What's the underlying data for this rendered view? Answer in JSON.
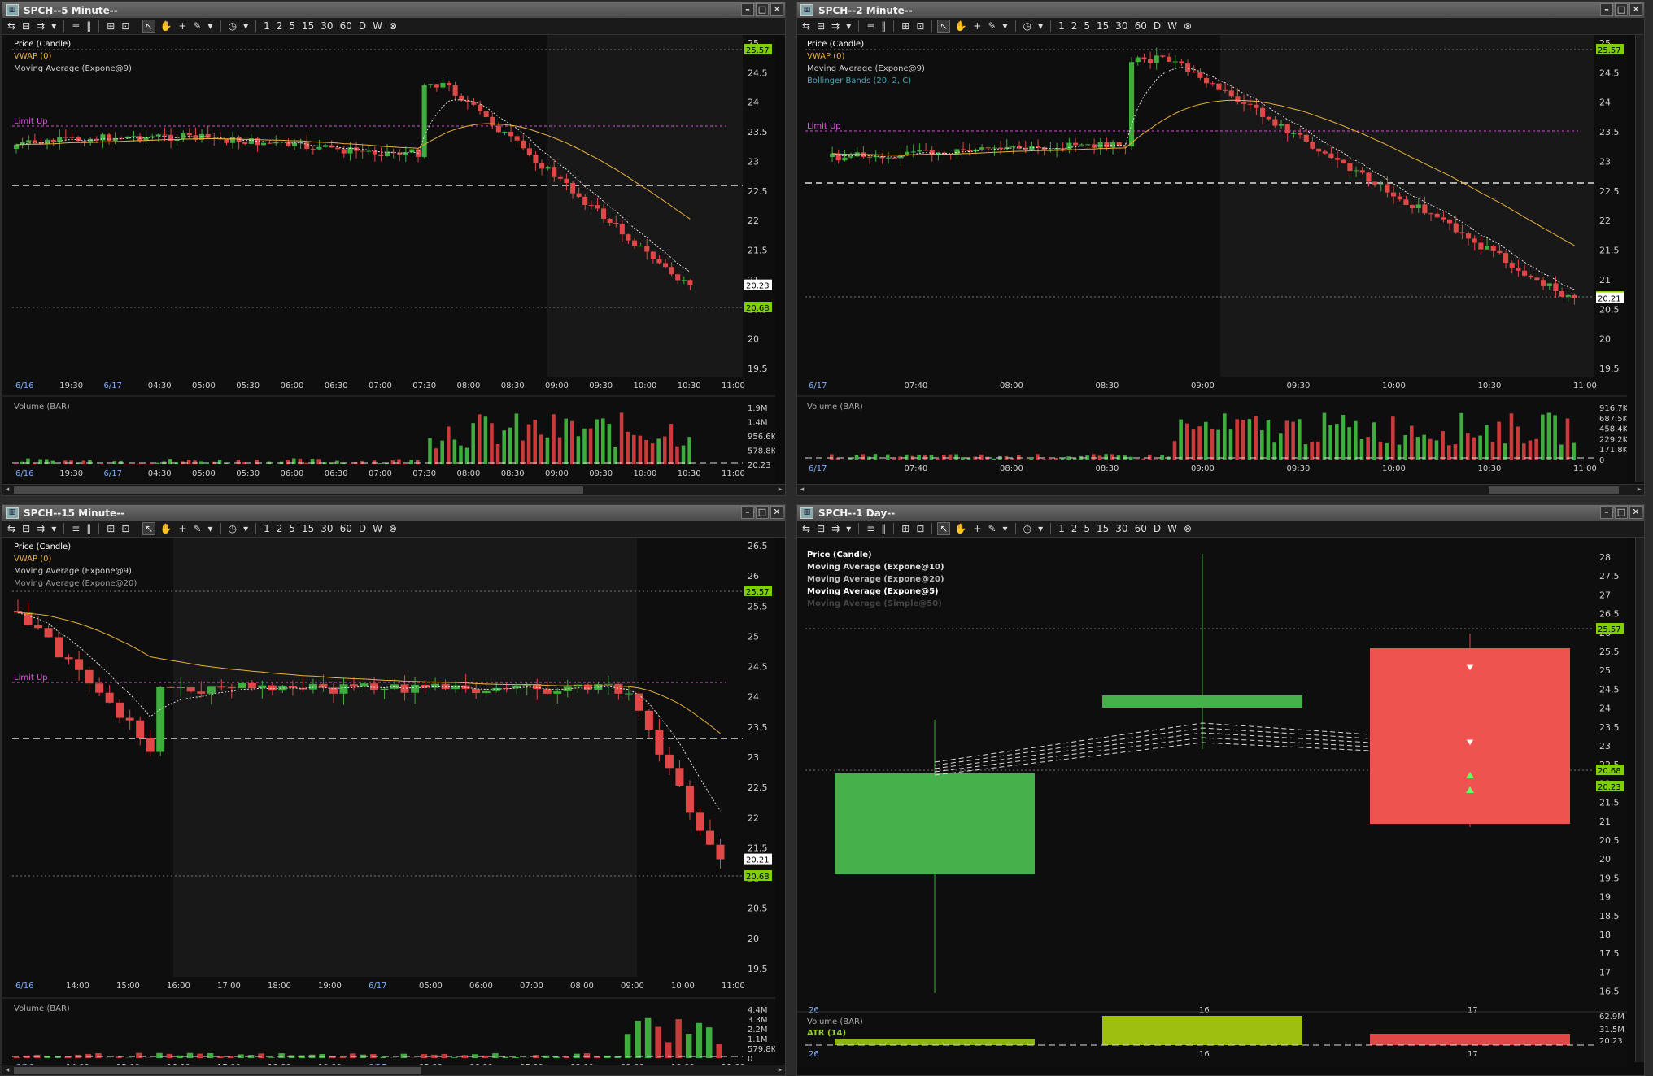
{
  "toolbar": {
    "items": [
      "⇆",
      "⊟",
      "⇉",
      "▾",
      "≡",
      "‖",
      "⊞",
      "⊡",
      "↖",
      "✋",
      "+",
      "✎",
      "▾",
      "◷",
      "▾",
      "1",
      "2",
      "5",
      "15",
      "30",
      "60",
      "D",
      "W",
      "⊗"
    ]
  },
  "window_controls": {
    "minimize": "–",
    "maximize": "□",
    "close": "✕"
  },
  "panels": [
    {
      "id": "p5m",
      "title": "SPCH--5 Minute--",
      "legend": [
        {
          "text": "Price (Candle)",
          "color": "#ffffff"
        },
        {
          "text": "VWAP (0)",
          "color": "#e8b23a"
        },
        {
          "text": "Moving Average (Expone@9)",
          "color": "#cfcfcf"
        }
      ],
      "limit_up_label": "Limit Up",
      "price_axis": [
        "25",
        "24.5",
        "24",
        "23.5",
        "23",
        "22.5",
        "22",
        "21.5",
        "21",
        "20.5",
        "20",
        "19.5"
      ],
      "price_tags": [
        {
          "text": "25.57",
          "bg": "#7fd000"
        },
        {
          "text": "20.68",
          "bg": "#7fd000"
        },
        {
          "text": "20.23",
          "bg": "#ffffff"
        }
      ],
      "time_axis": [
        "6/16",
        "19:30",
        "6/17",
        "04:30",
        "05:00",
        "05:30",
        "06:00",
        "06:30",
        "07:00",
        "07:30",
        "08:00",
        "08:30",
        "09:00",
        "09:30",
        "10:00",
        "10:30",
        "11:00"
      ],
      "volume_label": "Volume (BAR)",
      "volume_axis": [
        "1.9M",
        "1.4M",
        "956.6K",
        "578.8K",
        "20.23"
      ]
    },
    {
      "id": "p2m",
      "title": "SPCH--2 Minute--",
      "legend": [
        {
          "text": "Price (Candle)",
          "color": "#ffffff"
        },
        {
          "text": "VWAP (0)",
          "color": "#e8b23a"
        },
        {
          "text": "Moving Average (Expone@9)",
          "color": "#cfcfcf"
        },
        {
          "text": "Bollinger Bands (20, 2, C)",
          "color": "#4aa3b5"
        }
      ],
      "limit_up_label": "Limit Up",
      "price_axis": [
        "25",
        "24.5",
        "24",
        "23.5",
        "23",
        "22.5",
        "22",
        "21.5",
        "21",
        "20.5",
        "20",
        "19.5"
      ],
      "price_tags": [
        {
          "text": "25.57",
          "bg": "#7fd000"
        },
        {
          "text": "20.68",
          "bg": "#7fd000"
        },
        {
          "text": "20.21",
          "bg": "#ffffff"
        }
      ],
      "time_axis": [
        "6/17",
        "07:40",
        "08:00",
        "08:30",
        "09:00",
        "09:30",
        "10:00",
        "10:30",
        "11:00"
      ],
      "volume_label": "Volume (BAR)",
      "volume_axis": [
        "916.7K",
        "687.5K",
        "458.4K",
        "229.2K",
        "171.8K",
        "0"
      ]
    },
    {
      "id": "p15m",
      "title": "SPCH--15 Minute--",
      "legend": [
        {
          "text": "Price (Candle)",
          "color": "#ffffff"
        },
        {
          "text": "VWAP (0)",
          "color": "#e8b23a"
        },
        {
          "text": "Moving Average (Expone@9)",
          "color": "#cfcfcf"
        },
        {
          "text": "Moving Average (Expone@20)",
          "color": "#9a9a9a"
        }
      ],
      "limit_up_label": "Limit Up",
      "price_axis": [
        "26.5",
        "26",
        "25.5",
        "25",
        "24.5",
        "24",
        "23.5",
        "23",
        "22.5",
        "22",
        "21.5",
        "21",
        "20.5",
        "20",
        "19.5"
      ],
      "price_tags": [
        {
          "text": "25.57",
          "bg": "#7fd000"
        },
        {
          "text": "20.68",
          "bg": "#7fd000"
        },
        {
          "text": "20.21",
          "bg": "#ffffff"
        }
      ],
      "time_axis": [
        "6/16",
        "14:00",
        "15:00",
        "16:00",
        "17:00",
        "18:00",
        "19:00",
        "6/17",
        "05:00",
        "06:00",
        "07:00",
        "08:00",
        "09:00",
        "10:00",
        "11:00"
      ],
      "volume_label": "Volume (BAR)",
      "volume_axis": [
        "4.4M",
        "3.3M",
        "2.2M",
        "1.1M",
        "579.8K",
        "0"
      ]
    },
    {
      "id": "p1d",
      "title": "SPCH--1 Day--",
      "legend": [
        {
          "text": "Price (Candle)",
          "color": "#ffffff"
        },
        {
          "text": "Moving Average (Expone@10)",
          "color": "#dddddd"
        },
        {
          "text": "Moving Average (Expone@20)",
          "color": "#bbbbbb"
        },
        {
          "text": "Moving Average (Expone@5)",
          "color": "#ffffff"
        },
        {
          "text": "Moving Average (Simple@50)",
          "color": "#444444"
        }
      ],
      "price_axis": [
        "28",
        "27.5",
        "27",
        "26.5",
        "26",
        "25.5",
        "25",
        "24.5",
        "24",
        "23.5",
        "23",
        "22.5",
        "22",
        "21.5",
        "21",
        "20.5",
        "20",
        "19.5",
        "19",
        "18.5",
        "18",
        "17.5",
        "17",
        "16.5"
      ],
      "price_tags": [
        {
          "text": "25.57",
          "bg": "#7fd000"
        },
        {
          "text": "20.68",
          "bg": "#7fd000"
        },
        {
          "text": "20.23",
          "bg": "#7fd000"
        }
      ],
      "time_axis": [
        "26",
        "16",
        "17"
      ],
      "volume_label": "Volume (BAR)",
      "atr_label": "ATR (14)",
      "volume_axis": [
        "62.9M",
        "31.5M",
        "20.23"
      ]
    }
  ]
}
